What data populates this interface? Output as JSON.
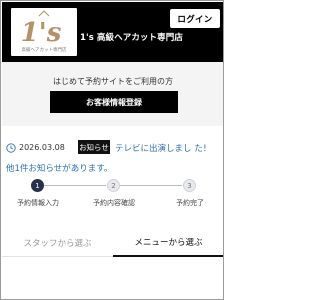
{
  "header": {
    "logo_text": "1's",
    "logo_caption": "高級ヘアカット専門店",
    "shop_name": "1's 高級ヘアカット専門店",
    "login_label": "ログイン"
  },
  "first_time": {
    "prompt": "はじめて予約サイトをご利用の方",
    "register_label": "お客様情報登録"
  },
  "news": {
    "date": "2026.03.08",
    "badge": "お知らせ",
    "headline": "テレビに出演しまし た！",
    "more": "他1件お知らせがあります。"
  },
  "steps": [
    {
      "number": "1",
      "label": "予約情報入力",
      "state": "active"
    },
    {
      "number": "2",
      "label": "予約内容確認",
      "state": "inactive"
    },
    {
      "number": "3",
      "label": "予約完了",
      "state": "inactive"
    }
  ],
  "tabs": [
    {
      "label": "スタッフから選ぶ",
      "state": "inactive"
    },
    {
      "label": "メニューから選ぶ",
      "state": "active"
    }
  ],
  "colors": {
    "header_bg": "#000000",
    "link": "#2f6fb8",
    "step_active": "#26324a",
    "logo_accent": "#b5916a"
  }
}
